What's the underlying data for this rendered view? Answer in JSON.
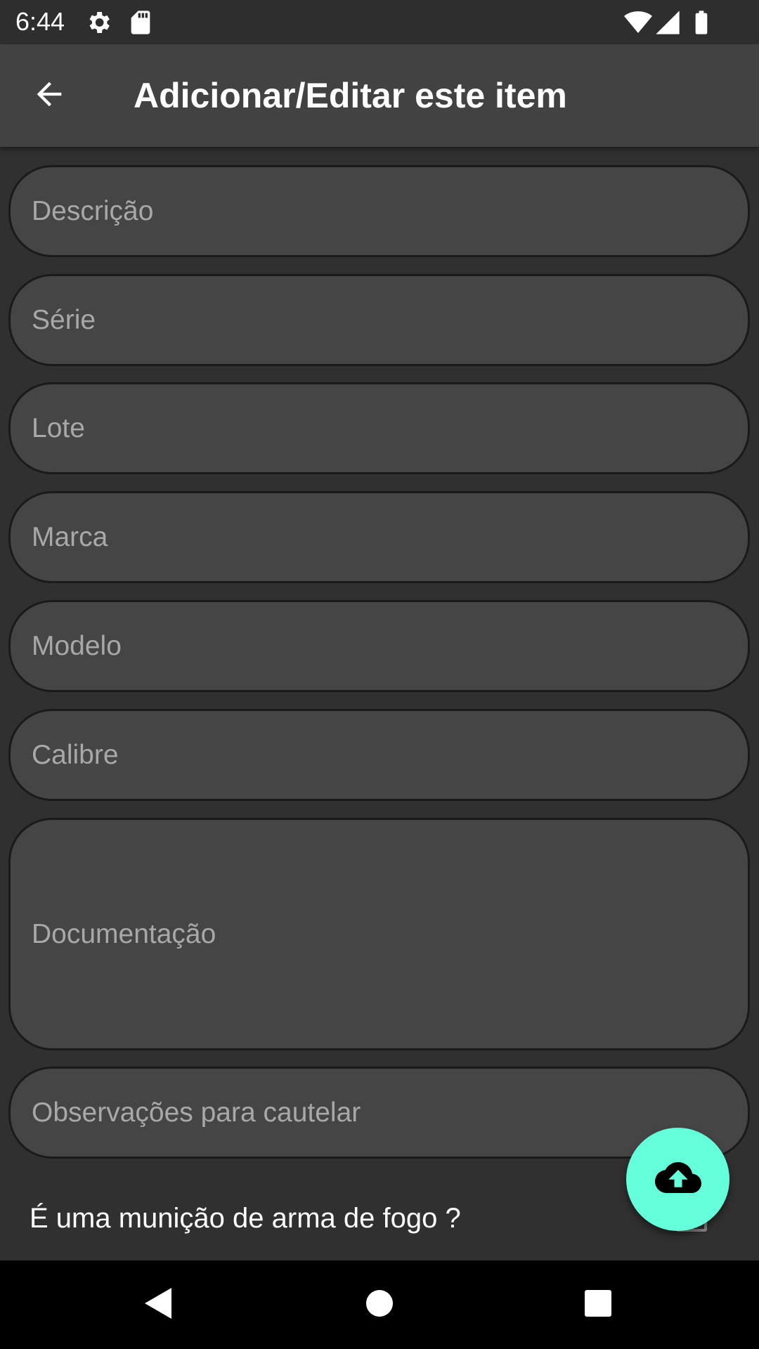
{
  "status_bar": {
    "time": "6:44",
    "icons": [
      "gear-icon",
      "sd-card-icon",
      "wifi-icon",
      "signal-icon",
      "battery-icon"
    ]
  },
  "app_bar": {
    "title": "Adicionar/Editar este item",
    "back_icon": "arrow-back-icon"
  },
  "form": {
    "fields": [
      {
        "placeholder": "Descrição",
        "value": ""
      },
      {
        "placeholder": "Série",
        "value": ""
      },
      {
        "placeholder": "Lote",
        "value": ""
      },
      {
        "placeholder": "Marca",
        "value": ""
      },
      {
        "placeholder": "Modelo",
        "value": ""
      },
      {
        "placeholder": "Calibre",
        "value": ""
      },
      {
        "placeholder": "Documentação",
        "value": ""
      },
      {
        "placeholder": "Observações para cautelar",
        "value": ""
      }
    ],
    "checkbox_label": "É uma munição de arma de fogo ?"
  },
  "fab": {
    "icon": "cloud-upload-icon",
    "color": "#64ffda"
  },
  "nav_bar": {
    "icons": [
      "back-triangle-icon",
      "home-circle-icon",
      "recents-square-icon"
    ]
  },
  "colors": {
    "background": "#303030",
    "app_bar": "#424242",
    "field_fill": "#454545",
    "accent": "#64ffda"
  }
}
